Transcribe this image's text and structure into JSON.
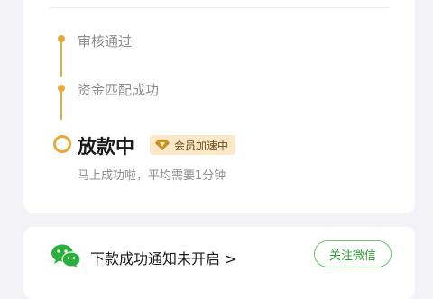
{
  "progress": {
    "steps": [
      {
        "label": "审核通过"
      },
      {
        "label": "资金匹配成功"
      }
    ],
    "current": {
      "label": "放款中",
      "badge": "会员加速中",
      "description": "马上成功啦，平均需要1分钟"
    },
    "accent_color": "#e6a93b"
  },
  "notice": {
    "text": "下款成功通知未开启 >",
    "follow_button_label": "关注微信",
    "icon": "wechat-icon",
    "button_color": "#2f9d36"
  }
}
